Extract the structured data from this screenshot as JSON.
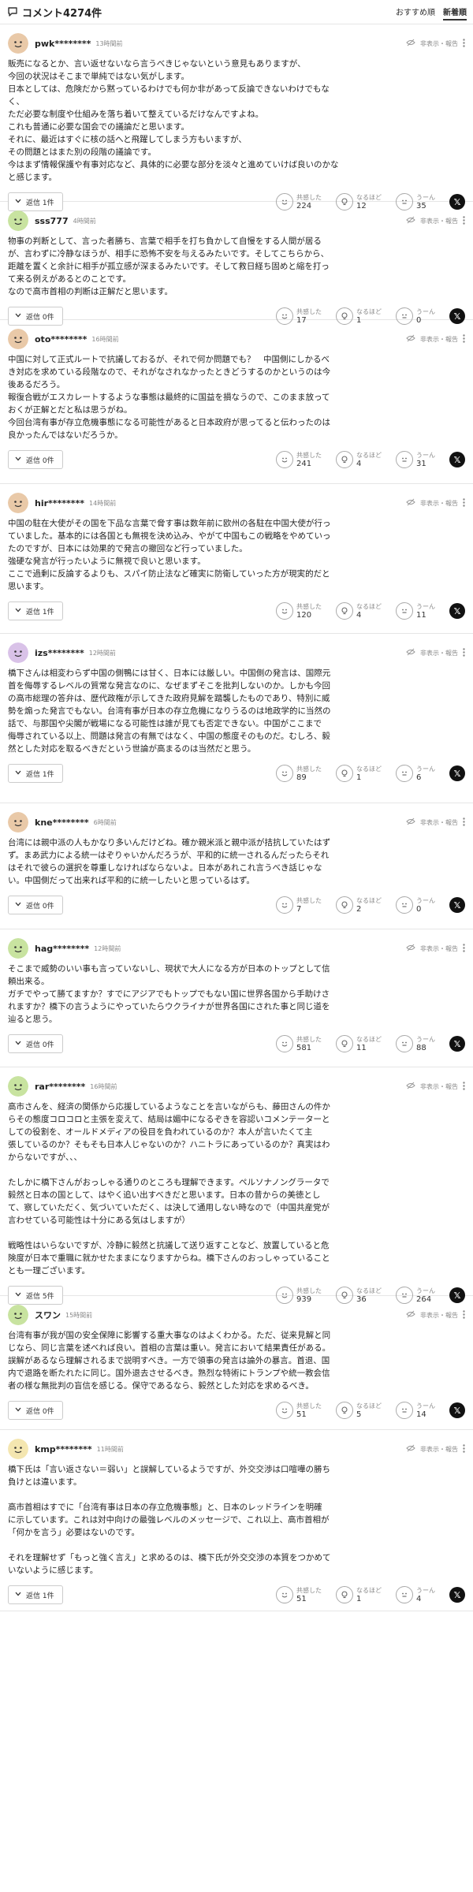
{
  "header": {
    "title": "コメント4274件",
    "sort_recommended": "おすすめ順",
    "sort_newest": "新着順"
  },
  "labels": {
    "report": "非表示・報告",
    "empathy": "共感した",
    "insight": "なるほど",
    "hmm": "うーん"
  },
  "comments": [
    {
      "user": "pwk********",
      "time": "13時間前",
      "avatar_color": "#e9c9a8",
      "lines": [
        "販売になるとか、言い返せないなら言うべきじゃないという意見もありますが、",
        "今回の状況はそこまで単純ではない気がします。",
        "日本としては、危険だから黙っているわけでも何か非があって反論できないわけでもな",
        "く、",
        "ただ必要な制度や仕組みを落ち着いて整えているだけなんですよね。",
        "これも普通に必要な国会での議論だと思います。",
        "それに、最近はすぐに核の話へと飛躍してしまう方もいますが、",
        "その問題とはまた別の段階の議論です。",
        "今はまず情報保護や有事対応など、具体的に必要な部分を淡々と進めていけば良いのかな",
        "と感じます。"
      ],
      "reply": "返信 1件",
      "empathy": "224",
      "insight": "12",
      "hmm": "35"
    },
    {
      "user": "sss777",
      "time": "4時間前",
      "avatar_color": "#c8e3a0",
      "lines": [
        "物事の判断として、言った者勝ち、言葉で相手を打ち負かして自慢をする人間が居る",
        "が、言わずに冷静なほうが、相手に恐怖不安を与えるみたいです。そしてこちらから、",
        "距離を置くと余計に相手が孤立感が深まるみたいです。そして救日経ち固めと縮を打っ",
        "て来る例えがあるとのことです。",
        "なので高市首相の判断は正解だと思います。"
      ],
      "reply": "返信 0件",
      "empathy": "17",
      "insight": "1",
      "hmm": "0"
    },
    {
      "user": "oto********",
      "time": "16時間前",
      "avatar_color": "#e9c9a8",
      "lines": [
        "中国に対して正式ルートで抗議しておるが、それで何か問題でも？　中国側にしかるべ",
        "き対応を求めている段階なので、それがなされなかったときどうするのかというのは今",
        "後あるだろう。",
        "報復合戦がエスカレートするような事態は最終的に国益を損なうので、このまま放って",
        "おくが正解とだと私は思うがね。",
        "今回台湾有事が存立危機事態になる可能性があると日本政府が思ってると伝わったのは",
        "良かったんではないだろうか。"
      ],
      "reply": "返信 0件",
      "empathy": "241",
      "insight": "4",
      "hmm": "31"
    },
    {
      "user": "hir********",
      "time": "14時間前",
      "avatar_color": "#e9c9a8",
      "lines": [
        "中国の駐在大使がその国を下品な言葉で脅す事は数年前に欧州の各駐在中国大使が行っ",
        "ていました。基本的には各国とも無視を決め込み、やがて中国もこの戦略をやめていっ",
        "たのですが、日本には効果的で発言の撤回など行っていました。",
        "強硬な発言が行ったいように無視で良いと思います。",
        "ここで過剰に反論するよりも、スパイ防止法など確実に防衛していった方が現実的だと",
        "思います。"
      ],
      "reply": "返信 1件",
      "empathy": "120",
      "insight": "4",
      "hmm": "11"
    },
    {
      "user": "izs********",
      "time": "12時間前",
      "avatar_color": "#d9c2e8",
      "lines": [
        "橋下さんは相変わらず中国の側鴨には甘く、日本には厳しい。中国側の発言は、国際元",
        "首を侮辱するレベルの質常な発言なのに、なぜまずそこを批判しないのか。しかも今回",
        "の高市総理の答弁は、歴代政権が示してきた政府見解を踏襲したものであり、特別に威",
        "勢を煽った発言でもない。台湾有事が日本の存立危機になりうるのは地政学的に当然の",
        "話で、与那国や尖閣が戦場になる可能性は誰が見ても否定できない。中国がここまで",
        "侮辱されている以上、問題は発言の有無ではなく、中国の態度そのものだ。むしろ、毅",
        "然とした対応を取るべきだという世論が高まるのは当然だと思う。"
      ],
      "reply": "返信 1件",
      "empathy": "89",
      "insight": "1",
      "hmm": "6"
    },
    {
      "user": "kne********",
      "time": "6時間前",
      "avatar_color": "#e9c9a8",
      "lines": [
        "台湾には親中派の人もかなり多いんだけどね。確か親米派と親中派が拮抗していたはず",
        "ず。まあ武力による統一はぞりゃいかんだろうが、平和的に統一されるんだったらそれ",
        "はそれで彼らの選択を尊重しなければならないよ。日本があれこれ言うべき話じゃな",
        "い。中国側だって出来れば平和的に統一したいと思っているはず。"
      ],
      "reply": "返信 0件",
      "empathy": "7",
      "insight": "2",
      "hmm": "0"
    },
    {
      "user": "hag********",
      "time": "12時間前",
      "avatar_color": "#c8e3a0",
      "lines": [
        "そこまで威勢のいい事も言っていないし、現状で大人になる方が日本のトップとして信",
        "頼出来る。",
        "ガチでやって勝てますか？すでにアジアでもトップでもない国に世界各国から手助けさ",
        "れますか？橋下の言うようにやっていたらウクライナが世界各国にされた事と同じ道を",
        "辿ると思う。"
      ],
      "reply": "返信 0件",
      "empathy": "581",
      "insight": "11",
      "hmm": "88"
    },
    {
      "user": "rar********",
      "time": "16時間前",
      "avatar_color": "#c8e3a0",
      "lines": [
        "高市さんを、経済の関係から応援しているようなことを言いながらも、藤田さんの件か",
        "らその態度コロコロと主張を変えて、結局は媚中になるぞきを容認いコメンテーターと",
        "しての役割を、オールドメディアの役目を負われているのか？本人が言いたくて主",
        "張しているのか？そもそも日本人じゃないのか？ハニトラにあっているのか？真実はわ",
        "からないですが、、、",
        "",
        "たしかに橋下さんがおっしゃる通りのところも理解できます。ペルソナノングラータで",
        "毅然と日本の国として、はやく追い出すべきだと思います。日本の昔からの美徳とし",
        "て、察していただく、気づいていただく、は決して通用しない時なので（中国共産党が",
        "言わせている可能性は十分にある気はしますが）",
        "",
        "戦略性はいらないですが、冷静に毅然と抗議して送り返すことなど、放置していると危",
        "険度が日本で重職に就かせたままになりますからね。橋下さんのおっしゃっていること",
        "とも一理ございます。"
      ],
      "reply": "返信 5件",
      "empathy": "939",
      "insight": "36",
      "hmm": "264"
    },
    {
      "user": "スワン",
      "time": "15時間前",
      "avatar_color": "#c8e3a0",
      "lines": [
        "台湾有事が我が国の安全保障に影響する重大事なのはよくわかる。ただ、従来見解と同",
        "じなら、同じ言葉を述べれば良い。首相の言葉は重い。発言において結果責任がある。",
        "誤解があるなら理解されるまで説明すべき。一方で領事の発言は論外の暴言。首退、国",
        "内で退路を断たれたに同じ。国外退去させるべき。熟烈な特術にトランプや統一教会信",
        "者の様な無批判の盲信を感じる。保守であるなら、毅然とした対応を求めるべき。"
      ],
      "reply": "返信 0件",
      "empathy": "51",
      "insight": "5",
      "hmm": "14"
    },
    {
      "user": "kmp********",
      "time": "11時間前",
      "avatar_color": "#f4e6b0",
      "lines": [
        "橋下氏は「言い返さない＝弱い」と誤解しているようですが、外交交渉は口喧嘩の勝ち",
        "負けとは違います。",
        "",
        "高市首相はすでに「台湾有事は日本の存立危機事態」と、日本のレッドラインを明確",
        "に示しています。これは対中向けの最強レベルのメッセージで、これ以上、高市首相が",
        "「何かを言う」必要はないのです。",
        "",
        "それを理解せず「もっと強く言え」と求めるのは、橋下氏が外交交渉の本質をつかめて",
        "いないように感じます。"
      ],
      "reply": "返信 1件",
      "empathy": "51",
      "insight": "1",
      "hmm": "4"
    }
  ]
}
